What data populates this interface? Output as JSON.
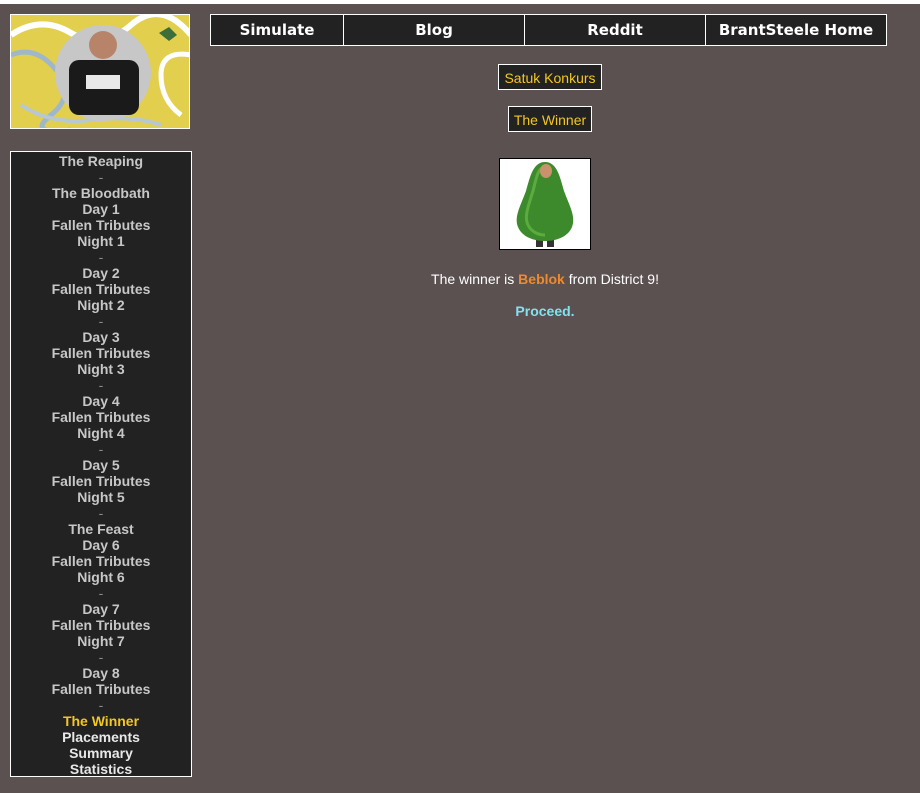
{
  "nav": {
    "items": [
      {
        "label": "Simulate"
      },
      {
        "label": "Blog"
      },
      {
        "label": "Reddit"
      },
      {
        "label": "BrantSteele Home"
      }
    ]
  },
  "game": {
    "title": "Satuk Konkurs",
    "section": "The Winner"
  },
  "winner": {
    "prefix": "The winner is ",
    "name": "Beblok",
    "suffix": " from District 9!",
    "proceed": "Proceed."
  },
  "sidebar": {
    "reaping": "The Reaping",
    "bloodbath": "The Bloodbath",
    "sep": "-",
    "day1": "Day 1",
    "fallen1": "Fallen Tributes",
    "night1": "Night 1",
    "day2": "Day 2",
    "fallen2": "Fallen Tributes",
    "night2": "Night 2",
    "day3": "Day 3",
    "fallen3": "Fallen Tributes",
    "night3": "Night 3",
    "day4": "Day 4",
    "fallen4": "Fallen Tributes",
    "night4": "Night 4",
    "day5": "Day 5",
    "fallen5": "Fallen Tributes",
    "night5": "Night 5",
    "feast": "The Feast",
    "day6": "Day 6",
    "fallen6": "Fallen Tributes",
    "night6": "Night 6",
    "day7": "Day 7",
    "fallen7": "Fallen Tributes",
    "night7": "Night 7",
    "day8": "Day 8",
    "fallen8": "Fallen Tributes",
    "winner": "The Winner",
    "placements": "Placements",
    "summary": "Summary",
    "statistics": "Statistics"
  },
  "colors": {
    "background": "#5b5151",
    "panel": "#222222",
    "accent": "#f3c623",
    "winner_name": "#f08a2a",
    "proceed": "#7fe3f0"
  },
  "icons": {
    "logo": "site-logo-image",
    "winner_avatar": "avocado-costume-avatar"
  }
}
